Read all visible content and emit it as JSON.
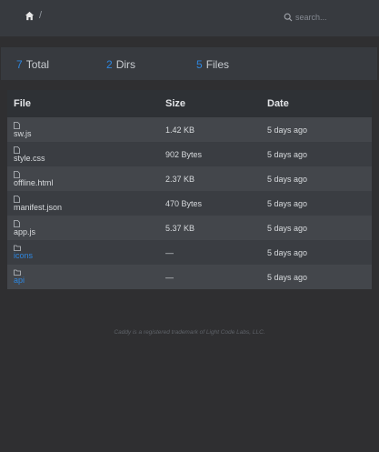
{
  "header": {
    "breadcrumb_sep": "/",
    "search_placeholder": "search..."
  },
  "summary": {
    "total_count": "7",
    "total_label": "Total",
    "dirs_count": "2",
    "dirs_label": "Dirs",
    "files_count": "5",
    "files_label": "Files"
  },
  "table": {
    "columns": [
      "File",
      "Size",
      "Date"
    ],
    "rows": [
      {
        "name": "sw.js",
        "size": "1.42 KB",
        "date": "5 days ago",
        "type": "file"
      },
      {
        "name": "style.css",
        "size": "902 Bytes",
        "date": "5 days ago",
        "type": "file"
      },
      {
        "name": "offline.html",
        "size": "2.37 KB",
        "date": "5 days ago",
        "type": "file"
      },
      {
        "name": "manifest.json",
        "size": "470 Bytes",
        "date": "5 days ago",
        "type": "file"
      },
      {
        "name": "app.js",
        "size": "5.37 KB",
        "date": "5 days ago",
        "type": "file"
      },
      {
        "name": "icons",
        "size": "—",
        "date": "5 days ago",
        "type": "dir"
      },
      {
        "name": "api",
        "size": "—",
        "date": "5 days ago",
        "type": "dir"
      }
    ]
  },
  "footer": {
    "text": "Caddy is a registered trademark of Light Code Labs, LLC."
  },
  "colors": {
    "accent": "#2e86de",
    "background": "#2f2f31",
    "bar": "#373a3f"
  }
}
